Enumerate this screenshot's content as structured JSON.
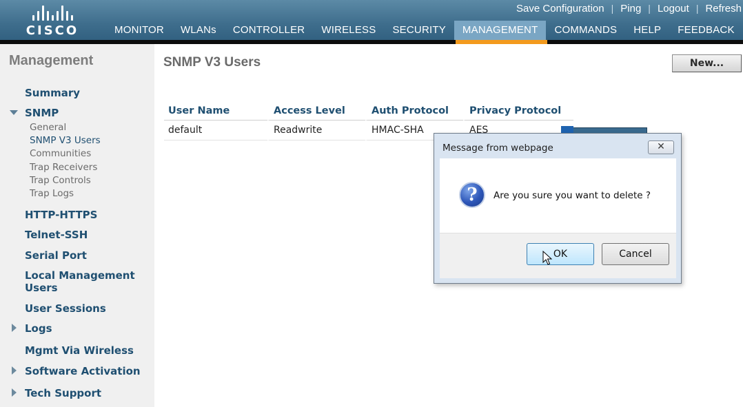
{
  "header": {
    "logo_text": "CISCO",
    "util_links": [
      "Save Configuration",
      "Ping",
      "Logout",
      "Refresh"
    ],
    "util_separator": "|",
    "nav": [
      {
        "label": "MONITOR",
        "active": false
      },
      {
        "label": "WLANs",
        "active": false
      },
      {
        "label": "CONTROLLER",
        "active": false
      },
      {
        "label": "WIRELESS",
        "active": false
      },
      {
        "label": "SECURITY",
        "active": false
      },
      {
        "label": "MANAGEMENT",
        "active": true
      },
      {
        "label": "COMMANDS",
        "active": false
      },
      {
        "label": "HELP",
        "active": false
      },
      {
        "label": "FEEDBACK",
        "active": false
      }
    ],
    "active_color": "#f39a1d"
  },
  "sidebar": {
    "title": "Management",
    "items": [
      {
        "label": "Summary",
        "expander": "none"
      },
      {
        "label": "SNMP",
        "expander": "expanded",
        "children": [
          "General",
          "SNMP V3 Users",
          "Communities",
          "Trap Receivers",
          "Trap Controls",
          "Trap Logs"
        ],
        "current_child": "SNMP V3 Users"
      },
      {
        "label": "HTTP-HTTPS",
        "expander": "none"
      },
      {
        "label": "Telnet-SSH",
        "expander": "none"
      },
      {
        "label": "Serial Port",
        "expander": "none"
      },
      {
        "label": "Local Management Users",
        "expander": "none"
      },
      {
        "label": "User Sessions",
        "expander": "none"
      },
      {
        "label": "Logs",
        "expander": "collapsed"
      },
      {
        "label": "Mgmt Via Wireless",
        "expander": "none"
      },
      {
        "label": "Software Activation",
        "expander": "collapsed"
      },
      {
        "label": "Tech Support",
        "expander": "collapsed"
      }
    ]
  },
  "main": {
    "title": "SNMP V3 Users",
    "new_button": "New...",
    "table": {
      "columns": [
        "User Name",
        "Access Level",
        "Auth Protocol",
        "Privacy Protocol"
      ],
      "rows": [
        [
          "default",
          "Readwrite",
          "HMAC-SHA",
          "AES"
        ]
      ]
    }
  },
  "dialog": {
    "title": "Message from webpage",
    "close_glyph": "✕",
    "icon": "question-icon",
    "icon_glyph": "?",
    "message": "Are you sure you want to delete ?",
    "ok": "OK",
    "cancel": "Cancel"
  }
}
